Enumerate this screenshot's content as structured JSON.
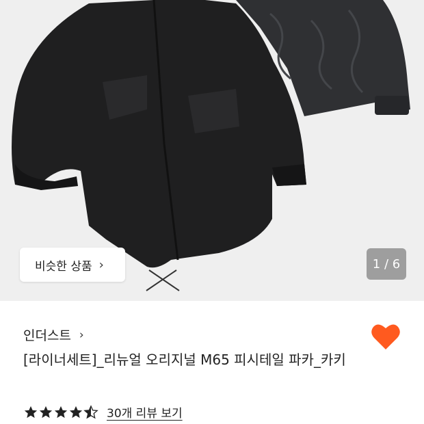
{
  "hero": {
    "image_alt": "black parka with quilted liner",
    "similar_button": {
      "label": "비슷한 상품",
      "icon": "chevron-right-icon"
    },
    "counter": "1 / 6"
  },
  "product": {
    "brand": "인더스트",
    "brand_icon": "chevron-right-icon",
    "title": "[라이너세트]_리뉴얼 오리지널 M65 피시테일 파카_카키",
    "wishlist_icon": "heart-icon",
    "wishlist_color": "#ff5a1f",
    "rating": 4.5,
    "reviews_label": "30개 리뷰 보기"
  }
}
